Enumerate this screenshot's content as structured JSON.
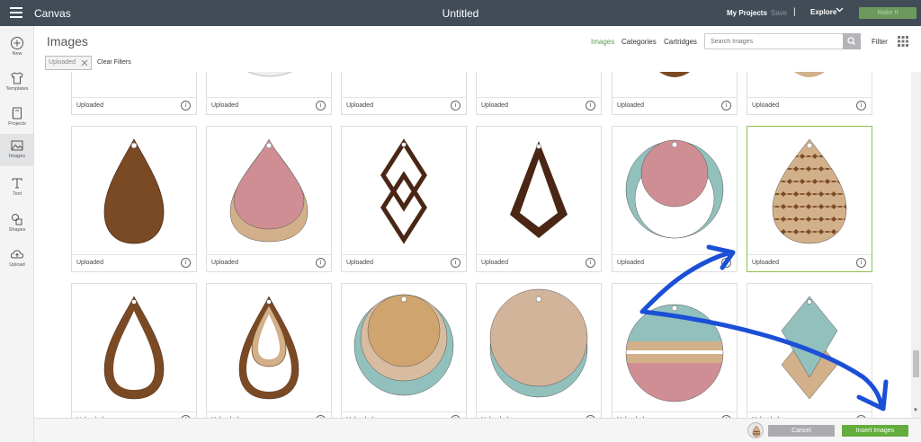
{
  "topbar": {
    "app_name": "Canvas",
    "document_title": "Untitled",
    "my_projects": "My Projects",
    "save": "Save",
    "separator": "|",
    "explore": "Explore",
    "make_it": "Make It"
  },
  "sidebar": {
    "items": [
      {
        "label": "New",
        "icon": "plus-circle-icon"
      },
      {
        "label": "Templates",
        "icon": "shirt-icon"
      },
      {
        "label": "Projects",
        "icon": "notebook-icon"
      },
      {
        "label": "Images",
        "icon": "image-icon",
        "active": true
      },
      {
        "label": "Text",
        "icon": "text-icon"
      },
      {
        "label": "Shapes",
        "icon": "shapes-icon"
      },
      {
        "label": "Upload",
        "icon": "cloud-upload-icon"
      }
    ]
  },
  "header": {
    "title": "Images",
    "tabs": [
      {
        "label": "Images",
        "active": true
      },
      {
        "label": "Categories"
      },
      {
        "label": "Cartridges"
      }
    ],
    "search_placeholder": "Search Images",
    "filter_label": "Filter"
  },
  "filters": {
    "chip_label": "Uploaded",
    "clear_label": "Clear Filters"
  },
  "tiles": {
    "label": "Uploaded",
    "info_glyph": "i",
    "rows": [
      [
        {
          "shape": "partial-white-hearts"
        },
        {
          "shape": "partial-white-oval"
        },
        {
          "shape": "blank"
        },
        {
          "shape": "blank"
        },
        {
          "shape": "partial-brown-arc"
        },
        {
          "shape": "partial-tan-arc"
        }
      ],
      [
        {
          "shape": "brown-teardrop"
        },
        {
          "shape": "pink-tan-teardrop"
        },
        {
          "shape": "double-diamond-outline"
        },
        {
          "shape": "kite-outline"
        },
        {
          "shape": "circle-ring"
        },
        {
          "shape": "scalloped-teardrop",
          "selected": true
        }
      ],
      [
        {
          "shape": "teardrop-outline"
        },
        {
          "shape": "double-teardrop-outline"
        },
        {
          "shape": "layered-circle-green"
        },
        {
          "shape": "layered-circle-tan"
        },
        {
          "shape": "striped-circle"
        },
        {
          "shape": "diamond-stack"
        }
      ]
    ]
  },
  "colors": {
    "topbar": "#414c57",
    "accent_green": "#62ad3c",
    "brown": "#7a4a25",
    "dark_brown": "#4a2614",
    "pink": "#cf8e93",
    "tan": "#d2b08a",
    "teal": "#92c0bd",
    "annotation_blue": "#1a4fd6"
  },
  "bottombar": {
    "cancel_label": "Cancel",
    "insert_label": "Insert Images"
  }
}
